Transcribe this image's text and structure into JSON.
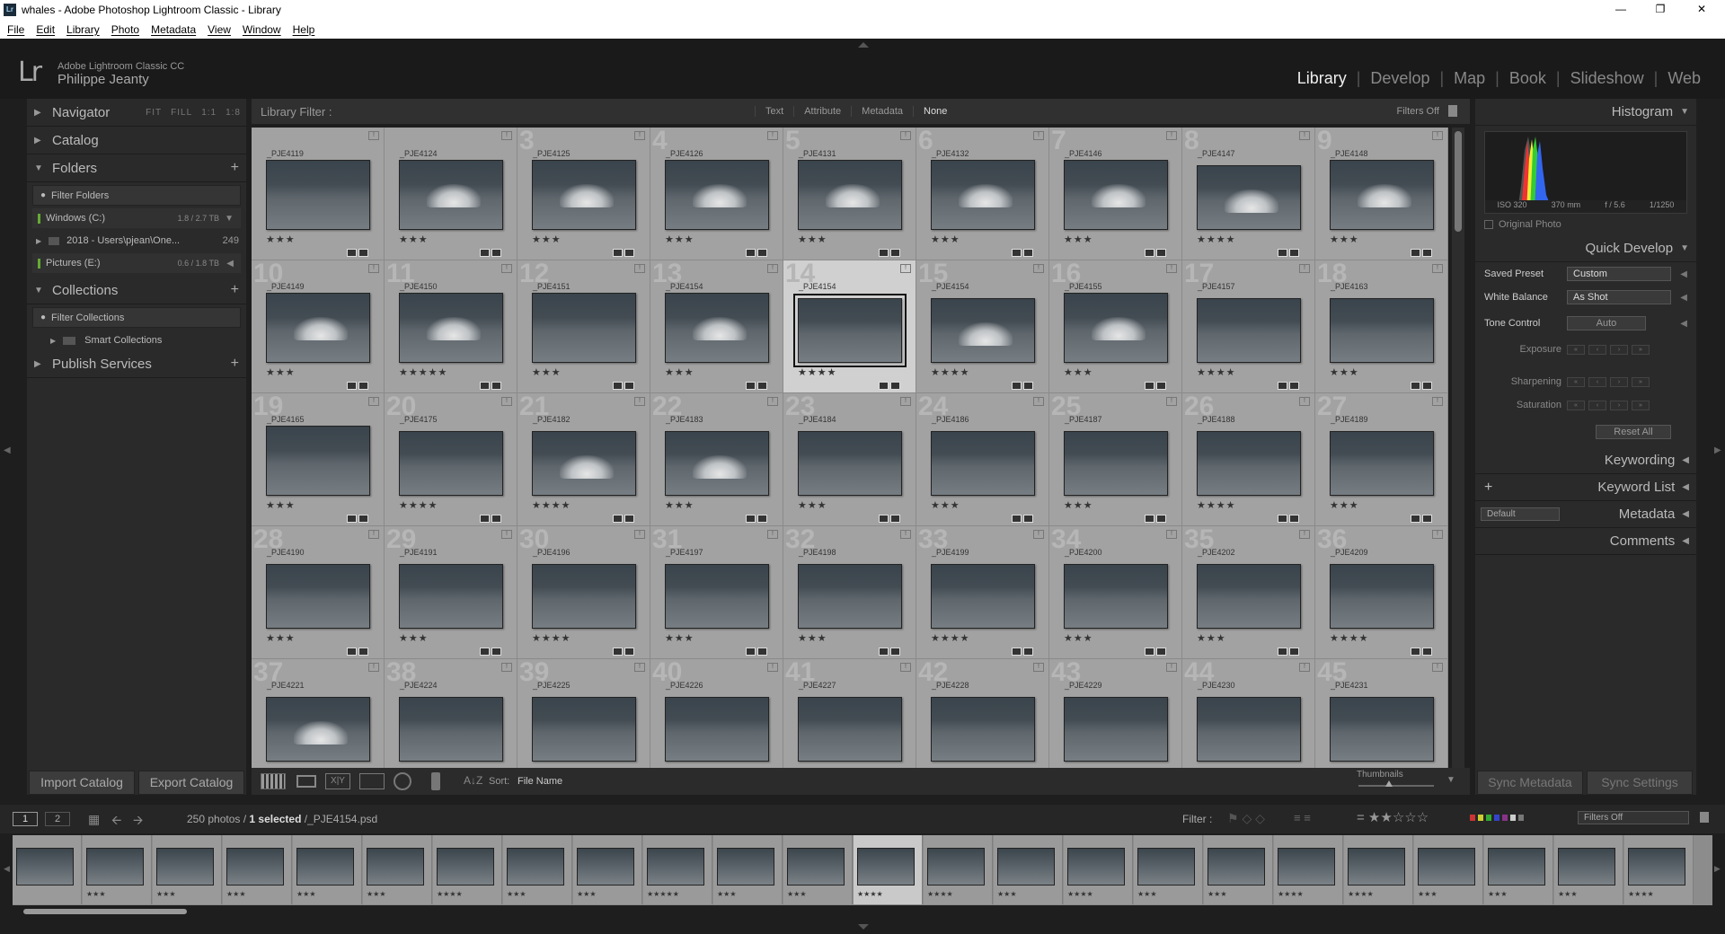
{
  "window": {
    "title": "whales - Adobe Photoshop Lightroom Classic - Library",
    "app_icon": "Lr"
  },
  "menu": [
    "File",
    "Edit",
    "Library",
    "Photo",
    "Metadata",
    "View",
    "Window",
    "Help"
  ],
  "identity": {
    "product": "Adobe Lightroom Classic CC",
    "user": "Philippe Jeanty",
    "logo": "Lr"
  },
  "modules": [
    "Library",
    "Develop",
    "Map",
    "Book",
    "Slideshow",
    "Web"
  ],
  "active_module": "Library",
  "left_panel": {
    "navigator": {
      "label": "Navigator",
      "options": [
        "FIT",
        "FILL",
        "1:1",
        "1:8"
      ]
    },
    "catalog": {
      "label": "Catalog"
    },
    "folders": {
      "label": "Folders",
      "filter_placeholder": "Filter Folders",
      "volumes": [
        {
          "name": "Windows (C:)",
          "size": "1.8 / 2.7 TB"
        },
        {
          "name": "Pictures (E:)",
          "size": "0.6 / 1.8 TB"
        }
      ],
      "subfolder": {
        "name": "2018 - Users\\pjean\\One...",
        "count": "249"
      }
    },
    "collections": {
      "label": "Collections",
      "filter_placeholder": "Filter Collections",
      "smart": "Smart Collections"
    },
    "publish": {
      "label": "Publish Services"
    },
    "import_label": "Import Catalog",
    "export_label": "Export Catalog"
  },
  "filter_bar": {
    "label": "Library Filter :",
    "options": [
      "Text",
      "Attribute",
      "Metadata",
      "None"
    ],
    "selected": "None",
    "status": "Filters Off"
  },
  "grid": [
    {
      "n": "",
      "file": "_PJE4119",
      "stars": "★★★",
      "splash": false
    },
    {
      "n": "",
      "file": "_PJE4124",
      "stars": "★★★",
      "splash": true
    },
    {
      "n": "3",
      "file": "_PJE4125",
      "stars": "★★★",
      "splash": true
    },
    {
      "n": "4",
      "file": "_PJE4126",
      "stars": "★★★",
      "splash": true
    },
    {
      "n": "5",
      "file": "_PJE4131",
      "stars": "★★★",
      "splash": true
    },
    {
      "n": "6",
      "file": "_PJE4132",
      "stars": "★★★",
      "splash": true
    },
    {
      "n": "7",
      "file": "_PJE4146",
      "stars": "★★★",
      "splash": true
    },
    {
      "n": "8",
      "file": "_PJE4147",
      "stars": "★★★★",
      "splash": true,
      "land": true
    },
    {
      "n": "9",
      "file": "_PJE4148",
      "stars": "★★★",
      "splash": true
    },
    {
      "n": "10",
      "file": "_PJE4149",
      "stars": "★★★",
      "splash": true
    },
    {
      "n": "11",
      "file": "_PJE4150",
      "stars": "★★★★★",
      "splash": true
    },
    {
      "n": "12",
      "file": "_PJE4151",
      "stars": "★★★",
      "splash": false
    },
    {
      "n": "13",
      "file": "_PJE4154",
      "stars": "★★★",
      "splash": true
    },
    {
      "n": "14",
      "file": "_PJE4154",
      "stars": "★★★★",
      "splash": false,
      "selected": true,
      "land": true
    },
    {
      "n": "15",
      "file": "_PJE4154",
      "stars": "★★★★",
      "splash": true,
      "land": true
    },
    {
      "n": "16",
      "file": "_PJE4155",
      "stars": "★★★",
      "splash": true
    },
    {
      "n": "17",
      "file": "_PJE4157",
      "stars": "★★★★",
      "splash": false,
      "land": true
    },
    {
      "n": "18",
      "file": "_PJE4163",
      "stars": "★★★",
      "splash": false,
      "land": true
    },
    {
      "n": "19",
      "file": "_PJE4165",
      "stars": "★★★",
      "splash": false
    },
    {
      "n": "20",
      "file": "_PJE4175",
      "stars": "★★★★",
      "splash": false,
      "land": true
    },
    {
      "n": "21",
      "file": "_PJE4182",
      "stars": "★★★★",
      "splash": true,
      "land": true
    },
    {
      "n": "22",
      "file": "_PJE4183",
      "stars": "★★★",
      "splash": true,
      "land": true
    },
    {
      "n": "23",
      "file": "_PJE4184",
      "stars": "★★★",
      "splash": false,
      "land": true
    },
    {
      "n": "24",
      "file": "_PJE4186",
      "stars": "★★★",
      "splash": false,
      "land": true
    },
    {
      "n": "25",
      "file": "_PJE4187",
      "stars": "★★★",
      "splash": false,
      "land": true
    },
    {
      "n": "26",
      "file": "_PJE4188",
      "stars": "★★★★",
      "splash": false,
      "land": true
    },
    {
      "n": "27",
      "file": "_PJE4189",
      "stars": "★★★",
      "splash": false,
      "land": true
    },
    {
      "n": "28",
      "file": "_PJE4190",
      "stars": "★★★",
      "splash": false,
      "land": true
    },
    {
      "n": "29",
      "file": "_PJE4191",
      "stars": "★★★",
      "splash": false,
      "land": true
    },
    {
      "n": "30",
      "file": "_PJE4196",
      "stars": "★★★★",
      "splash": false,
      "land": true
    },
    {
      "n": "31",
      "file": "_PJE4197",
      "stars": "★★★",
      "splash": false,
      "land": true
    },
    {
      "n": "32",
      "file": "_PJE4198",
      "stars": "★★★",
      "splash": false,
      "land": true
    },
    {
      "n": "33",
      "file": "_PJE4199",
      "stars": "★★★★",
      "splash": false,
      "land": true
    },
    {
      "n": "34",
      "file": "_PJE4200",
      "stars": "★★★",
      "splash": false,
      "land": true
    },
    {
      "n": "35",
      "file": "_PJE4202",
      "stars": "★★★",
      "splash": false,
      "land": true
    },
    {
      "n": "36",
      "file": "_PJE4209",
      "stars": "★★★★",
      "splash": false,
      "land": true
    },
    {
      "n": "37",
      "file": "_PJE4221",
      "stars": "",
      "splash": true,
      "land": true
    },
    {
      "n": "38",
      "file": "_PJE4224",
      "stars": "",
      "splash": false,
      "land": true
    },
    {
      "n": "39",
      "file": "_PJE4225",
      "stars": "",
      "splash": false,
      "land": true
    },
    {
      "n": "40",
      "file": "_PJE4226",
      "stars": "",
      "splash": false,
      "land": true
    },
    {
      "n": "41",
      "file": "_PJE4227",
      "stars": "",
      "splash": false,
      "land": true
    },
    {
      "n": "42",
      "file": "_PJE4228",
      "stars": "",
      "splash": false,
      "land": true
    },
    {
      "n": "43",
      "file": "_PJE4229",
      "stars": "",
      "splash": false,
      "land": true
    },
    {
      "n": "44",
      "file": "_PJE4230",
      "stars": "",
      "splash": false,
      "land": true
    },
    {
      "n": "45",
      "file": "_PJE4231",
      "stars": "",
      "splash": false,
      "land": true
    }
  ],
  "toolbar": {
    "sort_label": "Sort:",
    "sort_value": "File Name",
    "thumbnails_label": "Thumbnails",
    "sync_metadata": "Sync Metadata",
    "sync_settings": "Sync Settings"
  },
  "right_panel": {
    "histogram": {
      "label": "Histogram",
      "iso": "ISO 320",
      "focal": "370 mm",
      "aperture": "f / 5.6",
      "shutter": "1/1250",
      "original": "Original Photo"
    },
    "quick_develop": {
      "label": "Quick Develop",
      "saved_preset_label": "Saved Preset",
      "saved_preset": "Custom",
      "wb_label": "White Balance",
      "wb": "As Shot",
      "tone_label": "Tone Control",
      "auto": "Auto",
      "exposure": "Exposure",
      "sharpening": "Sharpening",
      "saturation": "Saturation",
      "reset": "Reset All"
    },
    "keywording": "Keywording",
    "keyword_list": "Keyword List",
    "metadata": "Metadata",
    "metadata_preset": "Default",
    "comments": "Comments"
  },
  "filmstrip": {
    "page1": "1",
    "page2": "2",
    "status_prefix": "250 photos / ",
    "status_selected": "1 selected",
    "status_suffix": " /_PJE4154.psd",
    "filter_label": "Filter :",
    "filter_value": "Filters Off",
    "stars": [
      "",
      "★★★",
      "★★★",
      "★★★",
      "★★★",
      "★★★",
      "★★★★",
      "★★★",
      "★★★",
      "★★★★★",
      "★★★",
      "★★★",
      "★★★★",
      "★★★★",
      "★★★",
      "★★★★",
      "★★★",
      "★★★",
      "★★★★",
      "★★★★",
      "★★★",
      "★★★",
      "★★★",
      "★★★★"
    ]
  }
}
